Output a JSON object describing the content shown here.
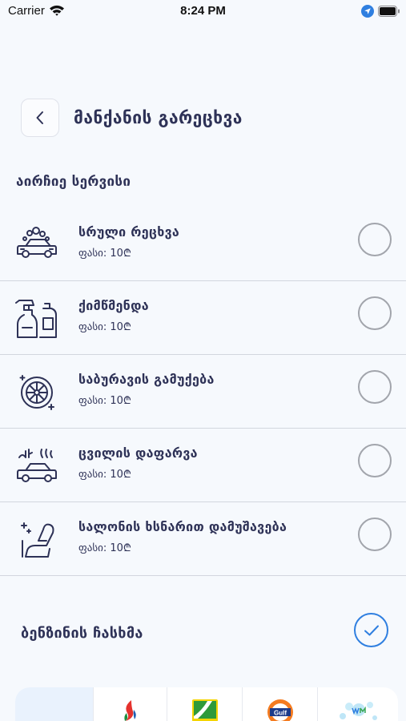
{
  "status_bar": {
    "carrier": "Carrier",
    "time": "8:24 PM"
  },
  "header": {
    "title": "მანქანის გარეცხვა",
    "back_icon": "chevron-left-icon"
  },
  "services_section": {
    "label": "აირჩიე სერვისი",
    "items": [
      {
        "name": "სრული რეცხვა",
        "price": "ფასი: 10₾",
        "icon": "car-wash-icon",
        "selected": false
      },
      {
        "name": "ქიმწმენდა",
        "price": "ფასი: 10₾",
        "icon": "cleaning-bottles-icon",
        "selected": false
      },
      {
        "name": "საბურავის გამუქება",
        "price": "ფასი: 10₾",
        "icon": "tire-icon",
        "selected": false
      },
      {
        "name": "ცვილის დაფარვა",
        "price": "ფასი: 10₾",
        "icon": "car-wax-icon",
        "selected": false
      },
      {
        "name": "სალონის ხსნარით დამუშავება",
        "price": "ფასი: 10₾",
        "icon": "car-seat-icon",
        "selected": false
      }
    ]
  },
  "fuel": {
    "label": "ბენზინის ჩასხმა",
    "checked": true
  },
  "brands": {
    "logos": [
      "socar-logo",
      "wissol-logo",
      "gulf-logo",
      "wash-logo"
    ],
    "gulf_text": "Gulf"
  },
  "colors": {
    "text": "#2e3257",
    "accent": "#2f7fe0",
    "radio_border": "#a2a5ac",
    "background": "#f6f9fd"
  }
}
